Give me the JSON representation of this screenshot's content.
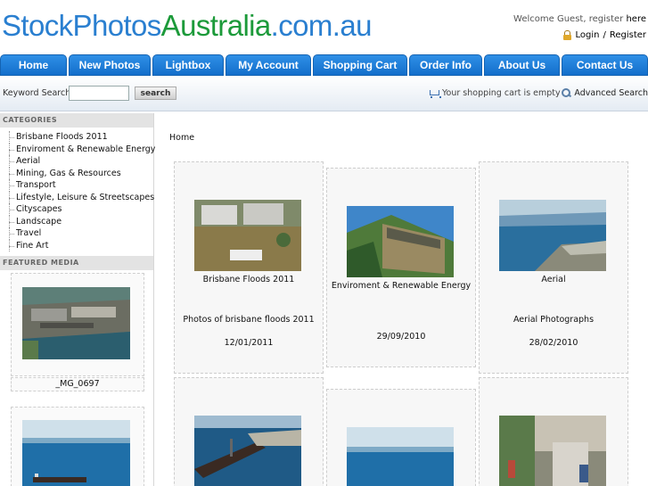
{
  "header": {
    "logo_part1": "StockPhotos",
    "logo_part2": "Australia",
    "logo_part3": ".com.au",
    "welcome": "Welcome Guest, register",
    "welcome_link": "here",
    "login": "Login",
    "separator": "/",
    "register": "Register"
  },
  "nav": [
    "Home",
    "New Photos",
    "Lightbox",
    "My Account",
    "Shopping Cart",
    "Order Info",
    "About Us",
    "Contact Us"
  ],
  "search": {
    "label": "Keyword Search",
    "value": "",
    "button": "search",
    "cart_status": "Your shopping cart is empty",
    "advanced": "Advanced Search"
  },
  "sidebar": {
    "categories_title": "CATEGORIES",
    "categories": [
      "Brisbane Floods 2011",
      "Enviroment & Renewable Energy",
      "Aerial",
      "Mining, Gas & Resources",
      "Transport",
      "Lifestyle, Leisure & Streetscapes",
      "Cityscapes",
      "Landscape",
      "Travel",
      "Fine Art"
    ],
    "featured_title": "FEATURED MEDIA",
    "featured": [
      {
        "caption": "_MG_0697",
        "image": "aerial-industrial-port"
      },
      {
        "caption": "",
        "image": "ship-on-ocean"
      }
    ]
  },
  "main": {
    "breadcrumb": "Home",
    "gallery": [
      {
        "title": "Brisbane Floods 2011",
        "description": "Photos of brisbane floods 2011",
        "date": "12/01/2011",
        "image": "flooded-houses"
      },
      {
        "title": "Enviroment & Renewable Energy",
        "description": "",
        "date": "29/09/2010",
        "image": "solar-building"
      },
      {
        "title": "Aerial",
        "description": "Aerial Photographs",
        "date": "28/02/2010",
        "image": "aerial-coast"
      },
      {
        "title": "",
        "description": "",
        "date": "",
        "image": "ship-at-wharf"
      },
      {
        "title": "",
        "description": "",
        "date": "",
        "image": "ship-on-ocean"
      },
      {
        "title": "",
        "description": "",
        "date": "",
        "image": "street-scene"
      }
    ]
  },
  "colors": {
    "logo_blue": "#2a7fd0",
    "logo_green": "#1c9a3a",
    "nav_blue": "#1d7fdb"
  }
}
